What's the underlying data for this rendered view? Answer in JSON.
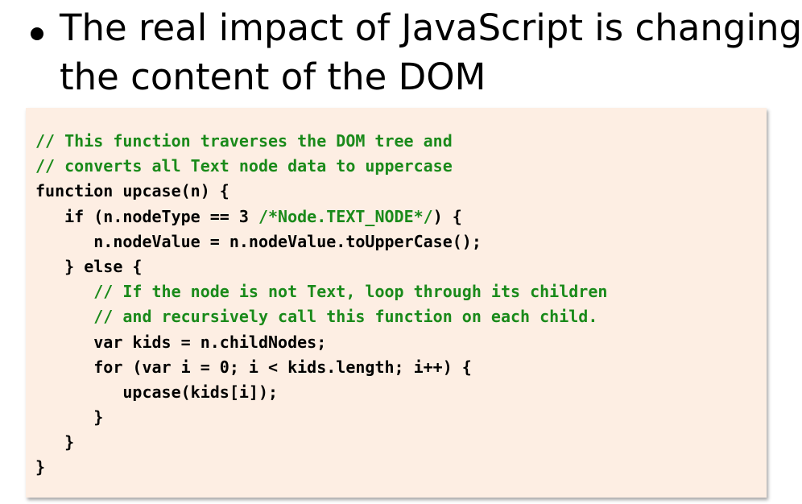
{
  "slide": {
    "bullet_lines": [
      "The real impact of JavaScript is changing",
      "the content of the DOM"
    ]
  },
  "code": {
    "colors": {
      "comment": "#1a8a1a",
      "code": "#000000",
      "background": "#fdeee3"
    },
    "lines": [
      {
        "indent": "",
        "code": "",
        "comment": "// This function traverses the DOM tree and"
      },
      {
        "indent": "",
        "code": "",
        "comment": "// converts all Text node data to uppercase"
      },
      {
        "indent": "",
        "code": "function upcase(n) {",
        "comment": ""
      },
      {
        "indent": "   ",
        "code": "if (n.nodeType == 3 ",
        "comment": "/*Node.TEXT_NODE*/",
        "tail": ") {"
      },
      {
        "indent": "      ",
        "code": "n.nodeValue = n.nodeValue.toUpperCase();",
        "comment": ""
      },
      {
        "indent": "   ",
        "code": "} else {",
        "comment": ""
      },
      {
        "indent": "      ",
        "code": "",
        "comment": "// If the node is not Text, loop through its children"
      },
      {
        "indent": "      ",
        "code": "",
        "comment": "// and recursively call this function on each child."
      },
      {
        "indent": "      ",
        "code": "var kids = n.childNodes;",
        "comment": ""
      },
      {
        "indent": "      ",
        "code": "for (var i = 0; i < kids.length; i++) {",
        "comment": ""
      },
      {
        "indent": "         ",
        "code": "upcase(kids[i]);",
        "comment": ""
      },
      {
        "indent": "      ",
        "code": "}",
        "comment": ""
      },
      {
        "indent": "   ",
        "code": "}",
        "comment": ""
      },
      {
        "indent": "",
        "code": "}",
        "comment": ""
      }
    ]
  }
}
